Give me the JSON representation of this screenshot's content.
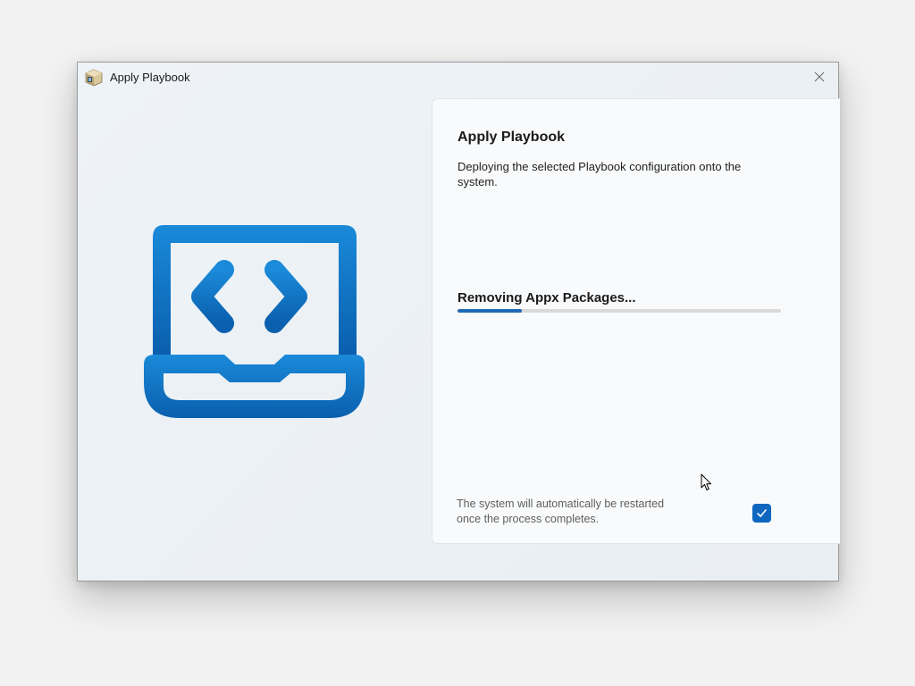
{
  "window": {
    "title": "Apply Playbook",
    "close_icon": "close-icon",
    "app_icon": "playbook-app-icon"
  },
  "hero": {
    "icon": "laptop-code-icon",
    "colors": {
      "top": "#1a8ad9",
      "bottom": "#0a5fae"
    }
  },
  "panel": {
    "title": "Apply Playbook",
    "description": "Deploying the selected Playbook configuration onto the system.",
    "status": "Removing Appx Packages...",
    "progress": 0.2,
    "restart_note": "The system will automatically be restarted once the process completes.",
    "restart_checked": true
  },
  "colors": {
    "accent": "#0f67c0",
    "progress_track": "#d9d9d9",
    "panel_bg": "#f9fafb"
  }
}
